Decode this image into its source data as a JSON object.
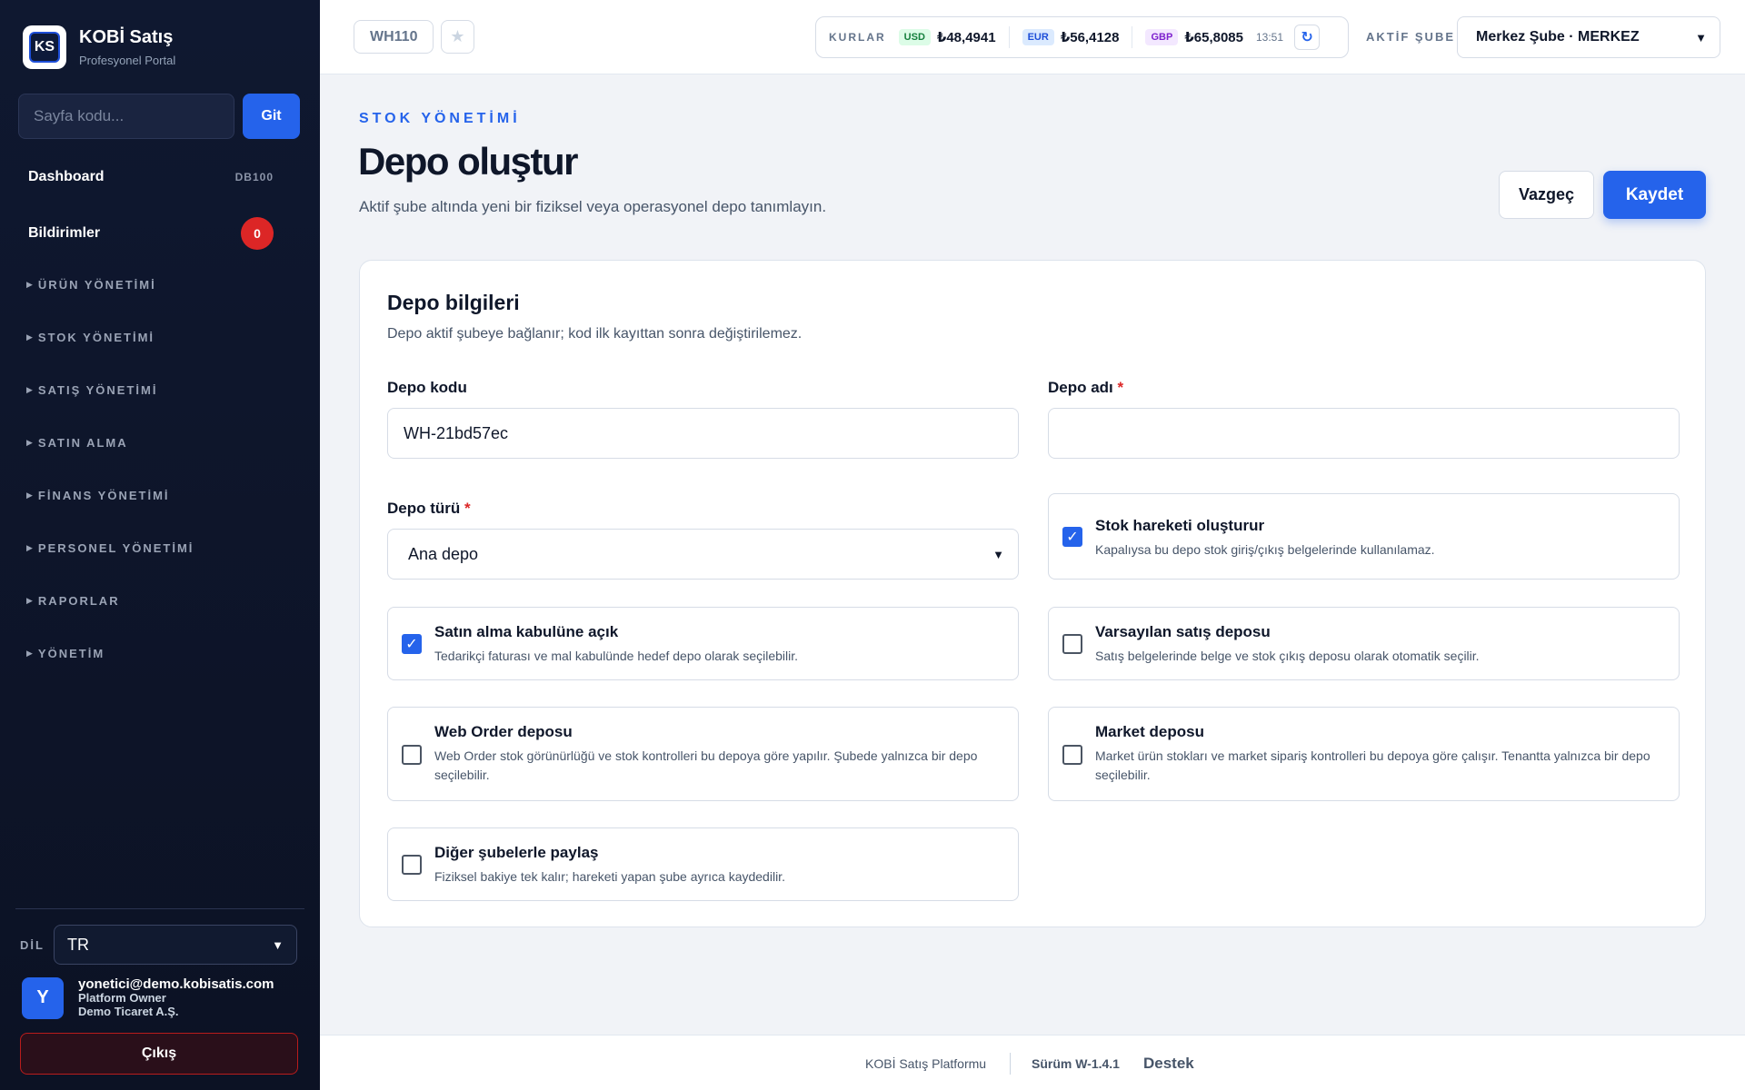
{
  "sidebar": {
    "brand_title": "KOBİ Satış",
    "brand_sub": "Profesyonel Portal",
    "logo_text": "KS",
    "goto_placeholder": "Sayfa kodu...",
    "goto_button": "Git",
    "main_items": [
      {
        "label": "Dashboard",
        "code": "DB100"
      },
      {
        "label": "Bildirimler",
        "count": "0"
      }
    ],
    "sections": [
      "ÜRÜN YÖNETİMİ",
      "STOK YÖNETİMİ",
      "SATIŞ YÖNETİMİ",
      "SATIN ALMA",
      "FİNANS YÖNETİMİ",
      "PERSONEL YÖNETİMİ",
      "RAPORLAR",
      "YÖNETİM"
    ],
    "language_label": "DİL",
    "language_value": "TR",
    "user": {
      "initial": "Y",
      "email": "yonetici@demo.kobisatis.com",
      "role": "Platform Owner",
      "company": "Demo Ticaret A.Ş."
    },
    "logout": "Çıkış"
  },
  "topbar": {
    "page_code": "WH110",
    "rates_title": "KURLAR",
    "rates": [
      {
        "code": "USD",
        "value": "₺48,4941",
        "bg": "#dcfce7",
        "fg": "#15803d"
      },
      {
        "code": "EUR",
        "value": "₺56,4128",
        "bg": "#dbeafe",
        "fg": "#1d4ed8"
      },
      {
        "code": "GBP",
        "value": "₺65,8085",
        "bg": "#f3e8ff",
        "fg": "#7e22ce"
      }
    ],
    "rates_time": "13:51",
    "branch_label": "AKTİF ŞUBE",
    "branch_value": "Merkez Şube · MERKEZ"
  },
  "header": {
    "eyebrow": "STOK YÖNETİMİ",
    "title": "Depo oluştur",
    "description": "Aktif şube altında yeni bir fiziksel veya operasyonel depo tanımlayın.",
    "cancel": "Vazgeç",
    "save": "Kaydet"
  },
  "form": {
    "title": "Depo bilgileri",
    "description": "Depo aktif şubeye bağlanır; kod ilk kayıttan sonra değiştirilemez.",
    "code_label": "Depo kodu",
    "code_value": "WH-21bd57ec",
    "name_label": "Depo adı",
    "name_value": "",
    "type_label": "Depo türü",
    "type_value": "Ana depo",
    "required_mark": "*",
    "options": [
      {
        "title": "Stok hareketi oluşturur",
        "desc": "Kapalıysa bu depo stok giriş/çıkış belgelerinde kullanılamaz.",
        "checked": true
      },
      {
        "title": "Satın alma kabulüne açık",
        "desc": "Tedarikçi faturası ve mal kabulünde hedef depo olarak seçilebilir.",
        "checked": true
      },
      {
        "title": "Varsayılan satış deposu",
        "desc": "Satış belgelerinde belge ve stok çıkış deposu olarak otomatik seçilir.",
        "checked": false
      },
      {
        "title": "Web Order deposu",
        "desc": "Web Order stok görünürlüğü ve stok kontrolleri bu depoya göre yapılır. Şubede yalnızca bir depo seçilebilir.",
        "checked": false
      },
      {
        "title": "Market deposu",
        "desc": "Market ürün stokları ve market sipariş kontrolleri bu depoya göre çalışır. Tenantta yalnızca bir depo seçilebilir.",
        "checked": false
      },
      {
        "title": "Diğer şubelerle paylaş",
        "desc": "Fiziksel bakiye tek kalır; hareketi yapan şube ayrıca kaydedilir.",
        "checked": false
      }
    ]
  },
  "footer": {
    "platform": "KOBİ Satış Platformu",
    "version": "Sürüm W-1.4.1",
    "support": "Destek"
  },
  "colors": {
    "accent": "#2563eb",
    "danger": "#dc2626",
    "sidebar": "#0f1830"
  }
}
